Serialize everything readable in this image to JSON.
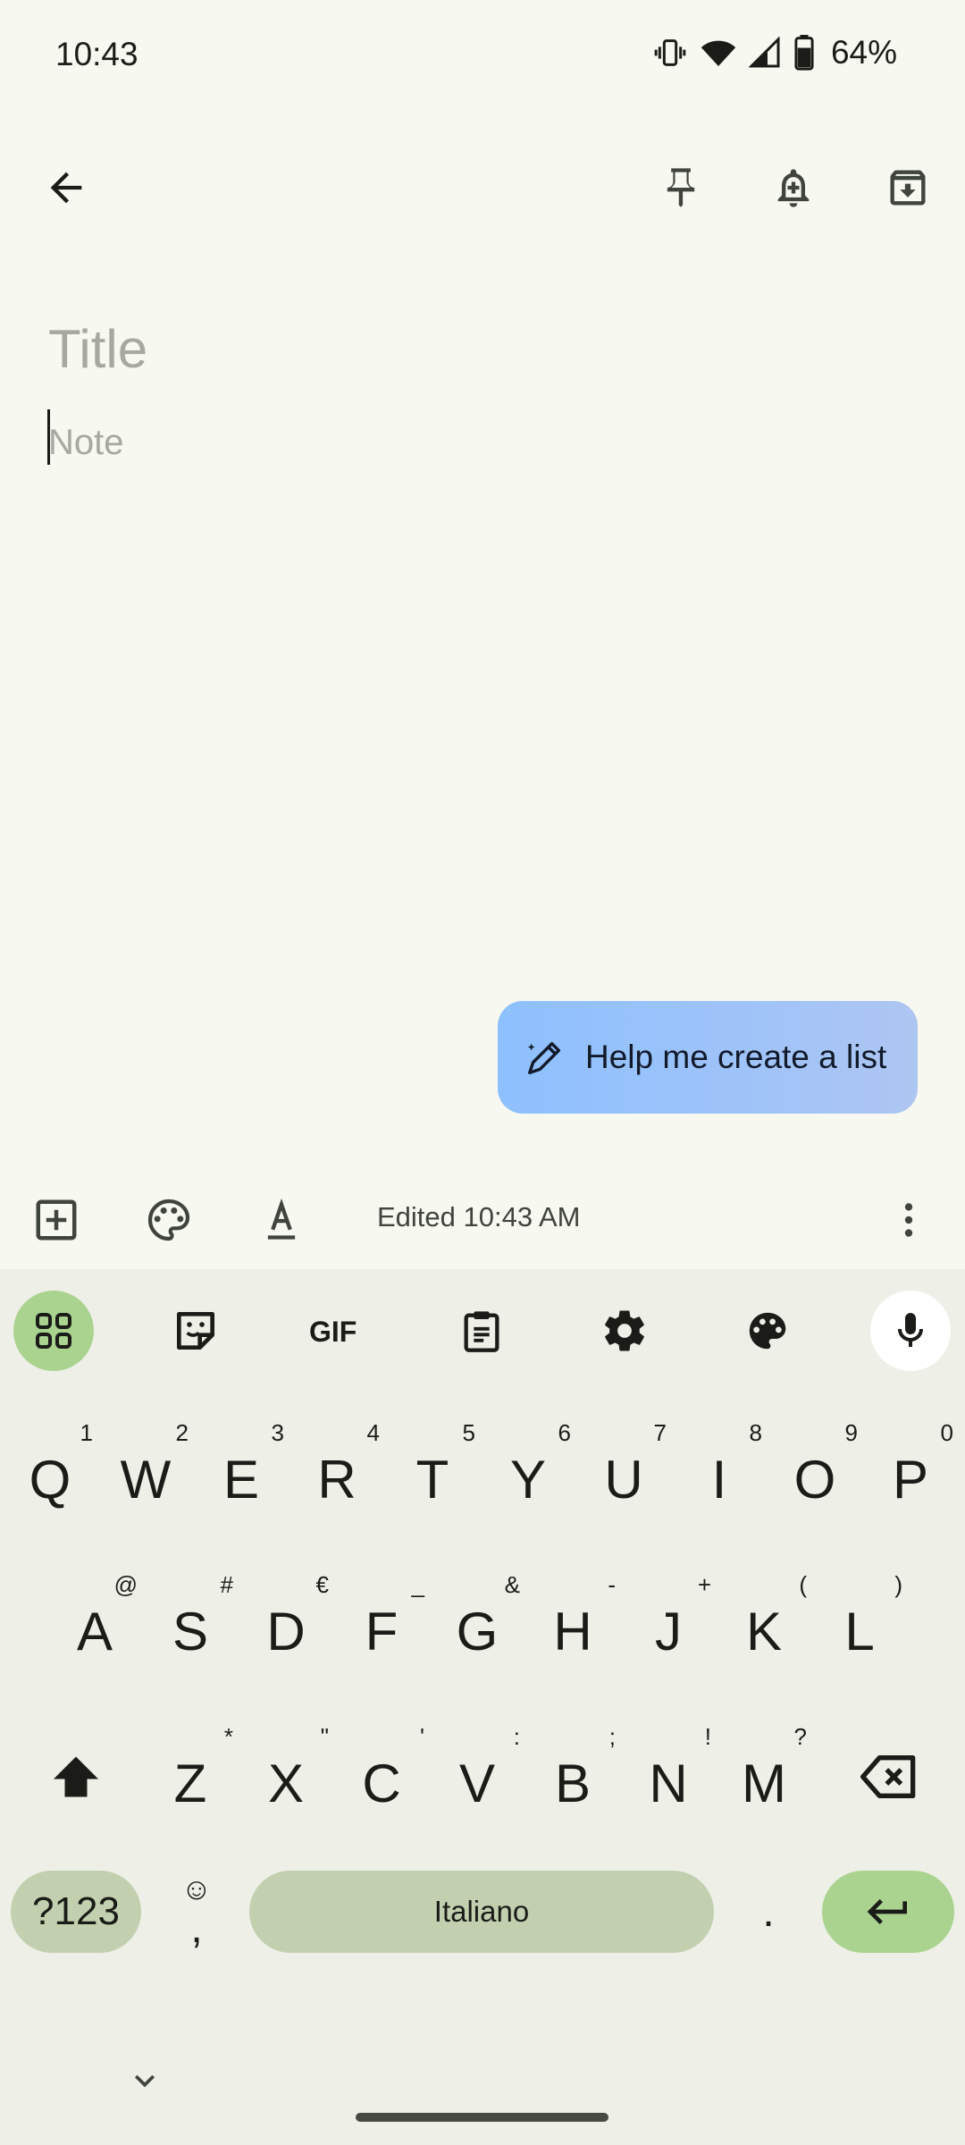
{
  "status_bar": {
    "time": "10:43",
    "battery": "64%"
  },
  "top_bar": {
    "back_icon": "arrow-left-icon",
    "pin_icon": "pin-icon",
    "reminder_icon": "bell-plus-icon",
    "archive_icon": "archive-icon"
  },
  "editor": {
    "title_placeholder": "Title",
    "note_placeholder": "Note",
    "title_value": "",
    "note_value": ""
  },
  "help_chip": {
    "label": "Help me create a list",
    "icon": "magic-pen-icon",
    "gradient_start": "#8ec0ff",
    "gradient_end": "#aec6f2"
  },
  "note_toolbar": {
    "edited": "Edited 10:43 AM"
  },
  "keyboard": {
    "rows": [
      [
        {
          "k": "Q",
          "h": "1"
        },
        {
          "k": "W",
          "h": "2"
        },
        {
          "k": "E",
          "h": "3"
        },
        {
          "k": "R",
          "h": "4"
        },
        {
          "k": "T",
          "h": "5"
        },
        {
          "k": "Y",
          "h": "6"
        },
        {
          "k": "U",
          "h": "7"
        },
        {
          "k": "I",
          "h": "8"
        },
        {
          "k": "O",
          "h": "9"
        },
        {
          "k": "P",
          "h": "0"
        }
      ],
      [
        {
          "k": "A",
          "h": "@"
        },
        {
          "k": "S",
          "h": "#"
        },
        {
          "k": "D",
          "h": "€"
        },
        {
          "k": "F",
          "h": "_"
        },
        {
          "k": "G",
          "h": "&"
        },
        {
          "k": "H",
          "h": "-"
        },
        {
          "k": "J",
          "h": "+"
        },
        {
          "k": "K",
          "h": "("
        },
        {
          "k": "L",
          "h": ")"
        }
      ],
      [
        {
          "k": "Z",
          "h": "*"
        },
        {
          "k": "X",
          "h": "\""
        },
        {
          "k": "C",
          "h": "'"
        },
        {
          "k": "V",
          "h": ":"
        },
        {
          "k": "B",
          "h": ";"
        },
        {
          "k": "N",
          "h": "!"
        },
        {
          "k": "M",
          "h": "?"
        }
      ]
    ],
    "symbols_label": "?123",
    "comma_label": ",",
    "emoji_hint": "☺",
    "space_label": "Italiano",
    "period_label": ".",
    "accent_color": "#a9d38f"
  }
}
